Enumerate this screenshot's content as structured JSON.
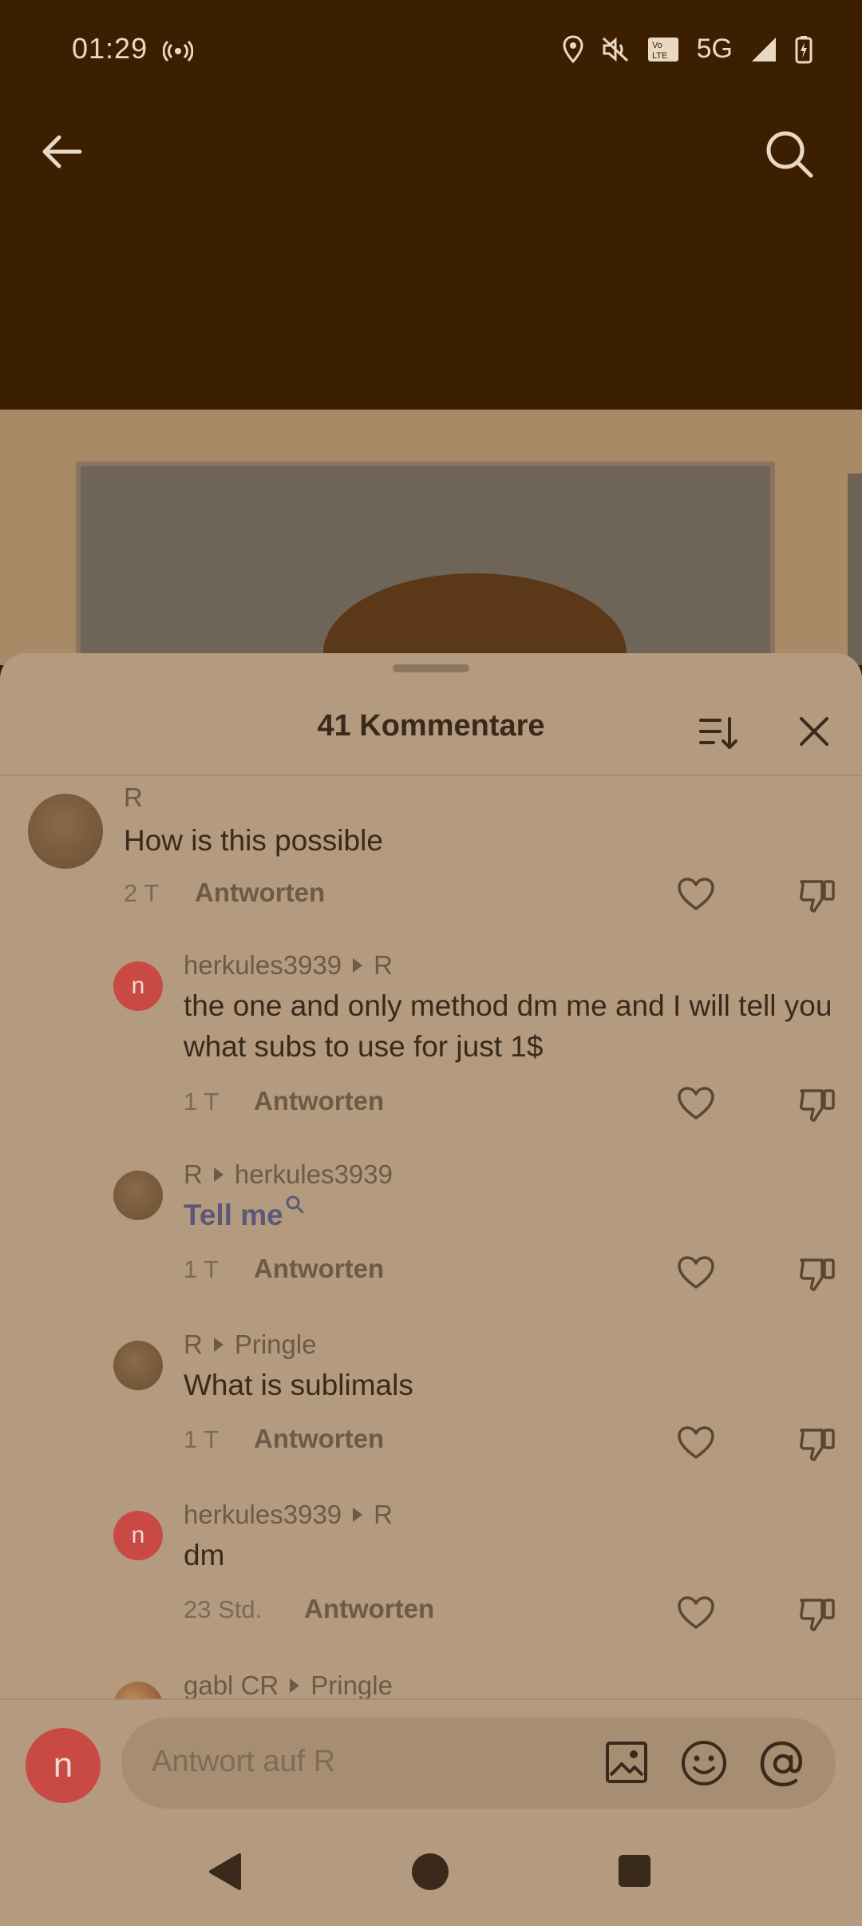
{
  "status_bar": {
    "time": "01:29",
    "network": "5G",
    "icons": [
      "hotspot-icon",
      "location-icon",
      "mute-icon",
      "volte-icon",
      "signal-icon",
      "battery-charging-icon"
    ]
  },
  "header": {
    "back_icon": "arrow-left-icon",
    "search_icon": "search-icon"
  },
  "sheet": {
    "title": "41 Kommentare",
    "sort_icon": "sort-icon",
    "close_icon": "close-icon"
  },
  "comments": [
    {
      "user": "R",
      "text": "How is this possible",
      "time": "2 T",
      "reply_label": "Antworten",
      "avatar": "brown"
    },
    {
      "user": "herkules3939",
      "reply_to": "R",
      "text": "the one and only method dm me and I will tell you what subs to use for just 1$",
      "time": "1 T",
      "reply_label": "Antworten",
      "avatar_letter": "n"
    },
    {
      "user": "R",
      "reply_to": "herkules3939",
      "text": "Tell me",
      "time": "1 T",
      "reply_label": "Antworten",
      "avatar": "brown"
    },
    {
      "user": "R",
      "reply_to": "Pringle",
      "text": "What is sublimals",
      "time": "1 T",
      "reply_label": "Antworten",
      "avatar": "brown"
    },
    {
      "user": "herkules3939",
      "reply_to": "R",
      "text": "dm",
      "time": "23 Std.",
      "reply_label": "Antworten",
      "avatar_letter": "n"
    },
    {
      "user": "gabl CR",
      "reply_to": "Pringle"
    }
  ],
  "composer": {
    "avatar_letter": "n",
    "placeholder": "Antwort auf R",
    "icons": [
      "image-icon",
      "emoji-icon",
      "at-icon"
    ]
  },
  "colors": {
    "sheet_bg": "#b49a7e",
    "header_bg": "#3b1f00",
    "link": "#5a5a78",
    "avatar_red": "#c94a45"
  }
}
